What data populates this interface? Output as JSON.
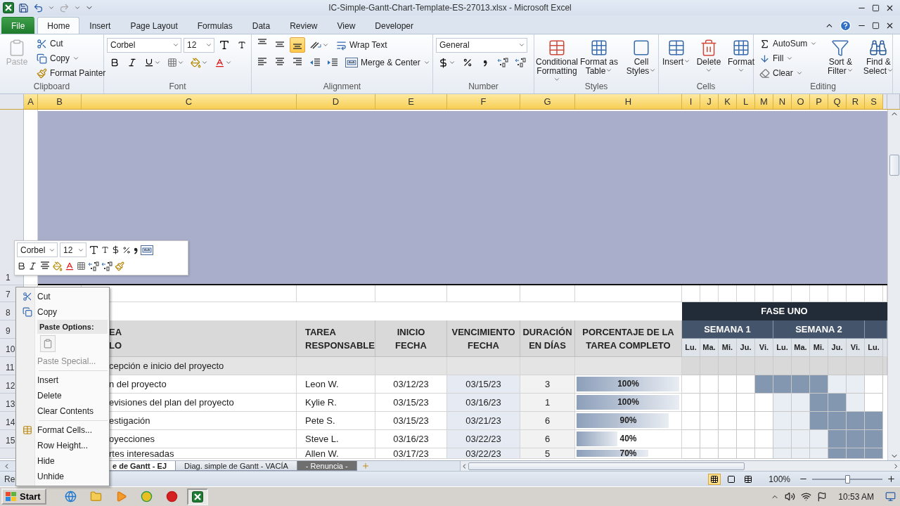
{
  "title_bar": {
    "title": "IC-Simple-Gantt-Chart-Template-ES-27013.xlsx -  Microsoft Excel"
  },
  "ribbon_tabs": [
    {
      "label": "File",
      "kind": "file",
      "selected": false
    },
    {
      "label": "Home",
      "kind": "tab",
      "selected": true
    },
    {
      "label": "Insert",
      "kind": "tab",
      "selected": false
    },
    {
      "label": "Page Layout",
      "kind": "tab",
      "selected": false
    },
    {
      "label": "Formulas",
      "kind": "tab",
      "selected": false
    },
    {
      "label": "Data",
      "kind": "tab",
      "selected": false
    },
    {
      "label": "Review",
      "kind": "tab",
      "selected": false
    },
    {
      "label": "View",
      "kind": "tab",
      "selected": false
    },
    {
      "label": "Developer",
      "kind": "tab",
      "selected": false
    }
  ],
  "ribbon_groups": [
    {
      "kind": "clipboard",
      "label": "Clipboard",
      "large": [
        {
          "label": "Paste",
          "disabled": true
        }
      ],
      "small": [
        {
          "label": "Cut"
        },
        {
          "label": "Copy"
        },
        {
          "label": "Format Painter"
        }
      ]
    },
    {
      "kind": "font",
      "label": "Font",
      "font": "Corbel",
      "size": "12"
    },
    {
      "kind": "alignment",
      "label": "Alignment",
      "vertical_align": [
        {
          "selected": false
        },
        {
          "selected": false
        },
        {
          "selected": true
        }
      ],
      "small": [
        {
          "label": "Wrap Text"
        },
        {
          "label": "Merge & Center"
        }
      ]
    },
    {
      "kind": "number",
      "label": "Number",
      "format": "General"
    },
    {
      "kind": "buttons",
      "label": "Styles",
      "large": [
        {
          "label": "Conditional Formatting"
        },
        {
          "label": "Format as Table"
        },
        {
          "label": "Cell Styles"
        }
      ]
    },
    {
      "kind": "buttons",
      "label": "Cells",
      "large": [
        {
          "label": "Insert"
        },
        {
          "label": "Delete"
        },
        {
          "label": "Format"
        }
      ]
    },
    {
      "kind": "editing",
      "label": "Editing",
      "small": [
        {
          "label": "AutoSum"
        },
        {
          "label": "Fill"
        },
        {
          "label": "Clear"
        }
      ],
      "large": [
        {
          "label": "Sort & Filter"
        },
        {
          "label": "Find & Select"
        }
      ]
    }
  ],
  "columns": [
    "A",
    "B",
    "C",
    "D",
    "E",
    "F",
    "G",
    "H",
    "I",
    "J",
    "K",
    "L",
    "M",
    "N",
    "O",
    "P",
    "Q",
    "R",
    "S"
  ],
  "row_numbers": [
    "1",
    "7",
    "8",
    "9",
    "10",
    "11",
    "12",
    "13",
    "14",
    "15"
  ],
  "table": {
    "title_header": "EA\nLO",
    "headers": [
      "TAREA\nRESPONSABLE",
      "INICIO\nFECHA",
      "VENCIMIENTO\nFECHA",
      "DURACIÓN\nEN DÍAS",
      "PORCENTAJE DE LA\nTAREA COMPLETO"
    ],
    "phase_row": {
      "title": "cepción e inicio del proyecto"
    },
    "tasks": [
      {
        "title": "n del proyecto",
        "owner": "Leon W.",
        "start": "03/12/23",
        "due": "03/15/23",
        "days": "3",
        "progress": "100%",
        "level": 1,
        "gantt": [
          false,
          false,
          false,
          false,
          true,
          true,
          true,
          true,
          false,
          false,
          false
        ]
      },
      {
        "title": "evisiones del plan del proyecto",
        "owner": "Kylie R.",
        "start": "03/15/23",
        "due": "03/16/23",
        "days": "1",
        "progress": "100%",
        "level": 1,
        "gantt": [
          false,
          false,
          false,
          false,
          false,
          false,
          false,
          true,
          true,
          false,
          false
        ]
      },
      {
        "title": "estigación",
        "owner": "Pete S.",
        "start": "03/15/23",
        "due": "03/21/23",
        "days": "6",
        "progress": "90%",
        "level": 0.9,
        "gantt": [
          false,
          false,
          false,
          false,
          false,
          false,
          false,
          true,
          true,
          true,
          true
        ]
      },
      {
        "title": "oyecciones",
        "owner": "Steve L.",
        "start": "03/16/23",
        "due": "03/22/23",
        "days": "6",
        "progress": "40%",
        "level": 0.4,
        "gantt": [
          false,
          false,
          false,
          false,
          false,
          false,
          false,
          false,
          true,
          true,
          true
        ]
      },
      {
        "title": "rtes interesadas",
        "owner": "Allen W.",
        "start": "03/17/23",
        "due": "03/22/23",
        "days": "5",
        "progress": "70%",
        "level": 0.7,
        "gantt": [
          false,
          false,
          false,
          false,
          false,
          false,
          false,
          false,
          true,
          true,
          true
        ]
      }
    ]
  },
  "gantt": {
    "phase": "FASE UNO",
    "weeks": [
      "SEMANA 1",
      "SEMANA 2"
    ],
    "days": [
      "Lu.",
      "Ma.",
      "Mi.",
      "Ju.",
      "Vi.",
      "Lu.",
      "Ma.",
      "Mi.",
      "Ju.",
      "Vi.",
      "Lu."
    ]
  },
  "mini_toolbar": {
    "font": "Corbel",
    "size": "12"
  },
  "context_menu": [
    {
      "kind": "item",
      "label": "Cut",
      "disabled": false
    },
    {
      "kind": "item",
      "label": "Copy",
      "disabled": false
    },
    {
      "kind": "header",
      "label": "Paste Options:"
    },
    {
      "kind": "paste_options"
    },
    {
      "kind": "item",
      "label": "Paste Special...",
      "disabled": true
    },
    {
      "kind": "separator"
    },
    {
      "kind": "item",
      "label": "Insert",
      "disabled": false
    },
    {
      "kind": "item",
      "label": "Delete",
      "disabled": false
    },
    {
      "kind": "item",
      "label": "Clear Contents",
      "disabled": false
    },
    {
      "kind": "separator"
    },
    {
      "kind": "item",
      "label": "Format Cells...",
      "disabled": false
    },
    {
      "kind": "item",
      "label": "Row Height...",
      "disabled": false
    },
    {
      "kind": "item",
      "label": "Hide",
      "disabled": false
    },
    {
      "kind": "item",
      "label": "Unhide",
      "disabled": false
    }
  ],
  "sheet_tabs": [
    {
      "label": "e de Gantt - EJ",
      "selected": true
    },
    {
      "label": "Diag. simple de Gantt - VACÍA",
      "selected": false
    },
    {
      "label": "- Renuncia -",
      "selected": false,
      "color": "#6f6f6f"
    }
  ],
  "status_bar": {
    "text": "Re",
    "zoom": "100%",
    "zoom_slider": {
      "level": 0.5
    }
  },
  "taskbar": {
    "start": "Start",
    "clock": "10:53 AM",
    "apps": [
      {
        "selected": false
      },
      {
        "selected": false
      },
      {
        "selected": false
      },
      {
        "selected": false
      },
      {
        "selected": false
      },
      {
        "selected": true
      }
    ]
  }
}
